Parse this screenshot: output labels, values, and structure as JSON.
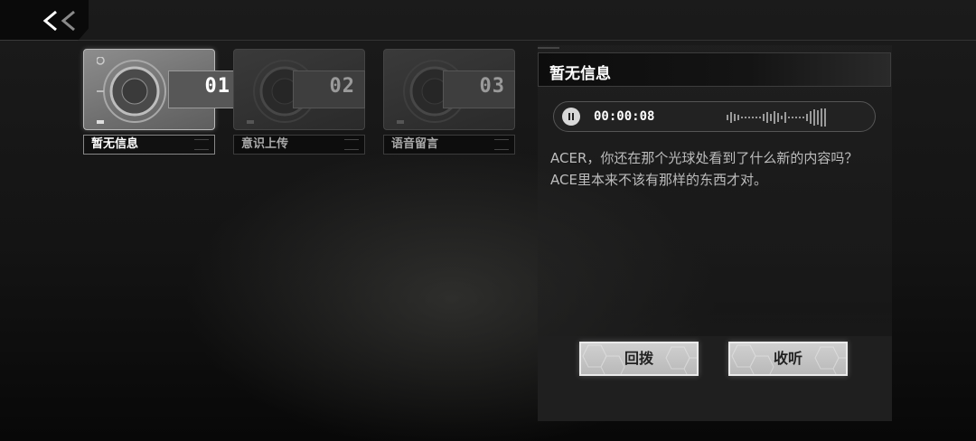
{
  "nav": {
    "back_icon": "double-chevron-left-icon"
  },
  "cards": [
    {
      "number": "01",
      "label": "暂无信息",
      "active": true
    },
    {
      "number": "02",
      "label": "意识上传",
      "active": false
    },
    {
      "number": "03",
      "label": "语音留言",
      "active": false
    }
  ],
  "detail": {
    "title": "暂无信息",
    "audio": {
      "time": "00:00:08",
      "play_icon": "pause-icon"
    },
    "message": "ACER，你还在那个光球处看到了什么新的内容吗？ACE里本来不该有那样的东西才对。",
    "buttons": {
      "callback": "回拨",
      "listen": "收听"
    }
  },
  "colors": {
    "accent": "#ffffff",
    "background": "#151515",
    "button": "#c8c8c8"
  }
}
